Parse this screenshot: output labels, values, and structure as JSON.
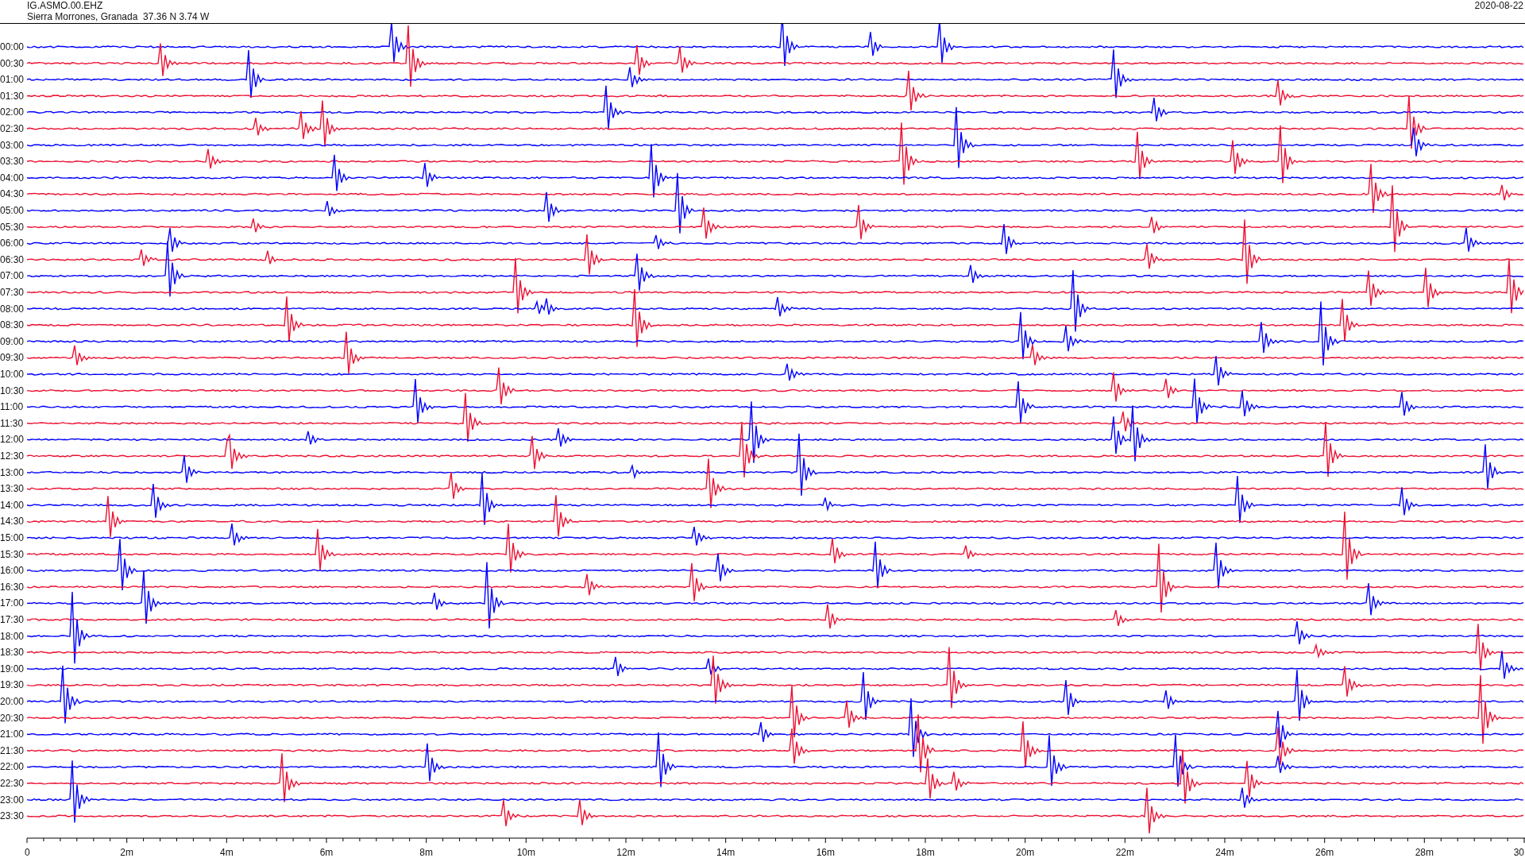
{
  "header": {
    "station": "IG.ASMO.00.EHZ",
    "location": "Sierra Morrones, Granada  37.36 N 3.74 W",
    "date": "2020-08-22"
  },
  "helicorder": {
    "rows": [
      {
        "label": "00:00",
        "color": "#0000ff"
      },
      {
        "label": "00:30",
        "color": "#ee1133"
      },
      {
        "label": "01:00",
        "color": "#0000ff"
      },
      {
        "label": "01:30",
        "color": "#ee1133"
      },
      {
        "label": "02:00",
        "color": "#0000ff"
      },
      {
        "label": "02:30",
        "color": "#ee1133"
      },
      {
        "label": "03:00",
        "color": "#0000ff"
      },
      {
        "label": "03:30",
        "color": "#ee1133"
      },
      {
        "label": "04:00",
        "color": "#0000ff"
      },
      {
        "label": "04:30",
        "color": "#ee1133"
      },
      {
        "label": "05:00",
        "color": "#0000ff"
      },
      {
        "label": "05:30",
        "color": "#ee1133"
      },
      {
        "label": "06:00",
        "color": "#0000ff"
      },
      {
        "label": "06:30",
        "color": "#ee1133"
      },
      {
        "label": "07:00",
        "color": "#0000ff"
      },
      {
        "label": "07:30",
        "color": "#ee1133"
      },
      {
        "label": "08:00",
        "color": "#0000ff"
      },
      {
        "label": "08:30",
        "color": "#ee1133"
      },
      {
        "label": "09:00",
        "color": "#0000ff"
      },
      {
        "label": "09:30",
        "color": "#ee1133"
      },
      {
        "label": "10:00",
        "color": "#0000ff"
      },
      {
        "label": "10:30",
        "color": "#ee1133"
      },
      {
        "label": "11:00",
        "color": "#0000ff"
      },
      {
        "label": "11:30",
        "color": "#ee1133"
      },
      {
        "label": "12:00",
        "color": "#0000ff"
      },
      {
        "label": "12:30",
        "color": "#ee1133"
      },
      {
        "label": "13:00",
        "color": "#0000ff"
      },
      {
        "label": "13:30",
        "color": "#ee1133"
      },
      {
        "label": "14:00",
        "color": "#0000ff"
      },
      {
        "label": "14:30",
        "color": "#ee1133"
      },
      {
        "label": "15:00",
        "color": "#0000ff"
      },
      {
        "label": "15:30",
        "color": "#ee1133"
      },
      {
        "label": "16:00",
        "color": "#0000ff"
      },
      {
        "label": "16:30",
        "color": "#ee1133"
      },
      {
        "label": "17:00",
        "color": "#0000ff"
      },
      {
        "label": "17:30",
        "color": "#ee1133"
      },
      {
        "label": "18:00",
        "color": "#0000ff"
      },
      {
        "label": "18:30",
        "color": "#ee1133"
      },
      {
        "label": "19:00",
        "color": "#0000ff"
      },
      {
        "label": "19:30",
        "color": "#ee1133"
      },
      {
        "label": "20:00",
        "color": "#0000ff"
      },
      {
        "label": "20:30",
        "color": "#ee1133"
      },
      {
        "label": "21:00",
        "color": "#0000ff"
      },
      {
        "label": "21:30",
        "color": "#ee1133"
      },
      {
        "label": "22:00",
        "color": "#0000ff"
      },
      {
        "label": "22:30",
        "color": "#ee1133"
      },
      {
        "label": "23:00",
        "color": "#0000ff"
      },
      {
        "label": "23:30",
        "color": "#ee1133"
      }
    ],
    "x_axis": {
      "ticks": [
        "0",
        "2m",
        "4m",
        "6m",
        "8m",
        "10m",
        "12m",
        "14m",
        "16m",
        "18m",
        "20m",
        "22m",
        "24m",
        "26m",
        "28m",
        "30"
      ]
    }
  }
}
